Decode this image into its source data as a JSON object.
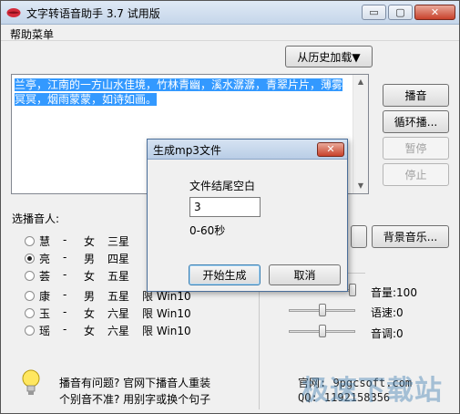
{
  "window": {
    "title": "文字转语音助手 3.7 试用版",
    "minimize_glyph": "▭",
    "restore_glyph": "▢",
    "close_glyph": "✕"
  },
  "menu": {
    "help_label": "帮助菜单"
  },
  "history_button": "从历史加载▼",
  "text_content": "兰亭，江南的一方山水佳境，竹林青幽，溪水潺潺，青翠片片，薄雾冥冥，烟雨蒙蒙，如诗如画。",
  "controls": {
    "play": "播音",
    "loop_play": "循环播...",
    "pause": "暂停",
    "stop": "停止",
    "bg_music": "背景音乐..."
  },
  "voices": {
    "label": "选播音人:",
    "items": [
      {
        "name": "慧",
        "dash": "-",
        "gender": "女",
        "stars": "三星",
        "limit": "",
        "checked": false
      },
      {
        "name": "亮",
        "dash": "-",
        "gender": "男",
        "stars": "四星",
        "limit": "",
        "checked": true
      },
      {
        "name": "荟",
        "dash": "-",
        "gender": "女",
        "stars": "五星",
        "limit": "",
        "checked": false
      },
      {
        "name": "康",
        "dash": "-",
        "gender": "男",
        "stars": "五星",
        "limit": "限 Win10",
        "checked": false
      },
      {
        "name": "玉",
        "dash": "-",
        "gender": "女",
        "stars": "六星",
        "limit": "限 Win10",
        "checked": false
      },
      {
        "name": "瑶",
        "dash": "-",
        "gender": "女",
        "stars": "六星",
        "limit": "限 Win10",
        "checked": false
      }
    ]
  },
  "sliders": {
    "volume_label": "音量:100",
    "speed_label": "语速:0",
    "pitch_label": "音调:0"
  },
  "hint": {
    "line1": "播音有问题? 官网下播音人重装",
    "line2": "个别音不准? 用别字或换个句子"
  },
  "contact": {
    "line1": "官网: 9pgcsoft.com",
    "line2": "QQ: 1192158356"
  },
  "watermark": "极速下载站",
  "dialog": {
    "title": "生成mp3文件",
    "field_label": "文件结尾空白",
    "field_value": "3",
    "range_label": "0-60秒",
    "ok": "开始生成",
    "cancel": "取消",
    "close_glyph": "✕"
  },
  "colors": {
    "selection": "#3399ff",
    "close_button": "#c8412b",
    "titlebar": "#c5d6ea"
  }
}
